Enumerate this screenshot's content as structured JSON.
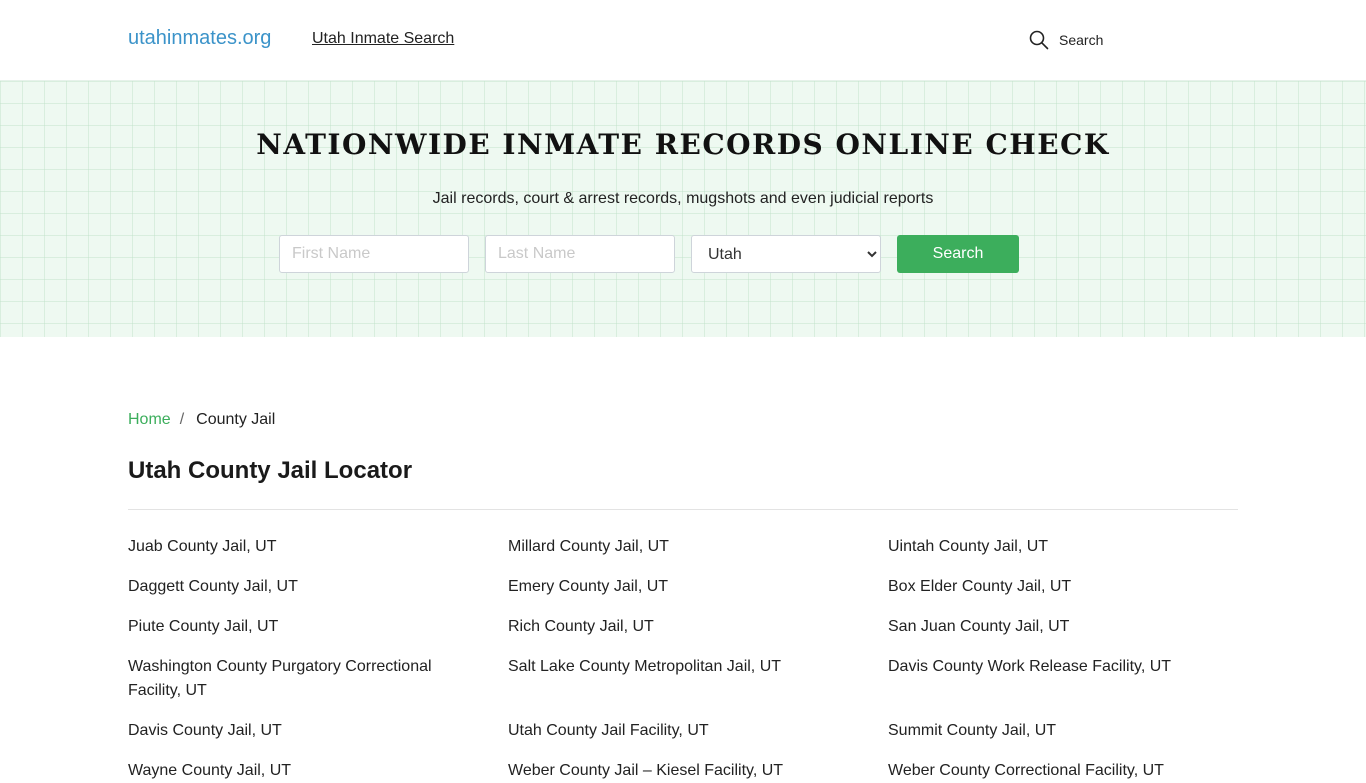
{
  "header": {
    "logo": "utahinmates.org",
    "nav_link": "Utah Inmate Search",
    "search_label": "Search"
  },
  "hero": {
    "title": "NATIONWIDE INMATE RECORDS ONLINE CHECK",
    "subtitle": "Jail records, court & arrest records, mugshots and even judicial reports",
    "first_name_placeholder": "First Name",
    "last_name_placeholder": "Last Name",
    "state_selected": "Utah",
    "search_button": "Search"
  },
  "breadcrumb": {
    "home": "Home",
    "separator": "/",
    "current": "County Jail"
  },
  "page_title": "Utah County Jail Locator",
  "jails": [
    "Juab County Jail, UT",
    "Millard County Jail, UT",
    "Uintah County Jail, UT",
    "Daggett County Jail, UT",
    "Emery County Jail, UT",
    "Box Elder County Jail, UT",
    "Piute County Jail, UT",
    "Rich County Jail, UT",
    "San Juan County Jail, UT",
    "Washington County Purgatory Correctional Facility, UT",
    "Salt Lake County Metropolitan Jail, UT",
    "Davis County Work Release Facility, UT",
    "Davis County Jail, UT",
    "Utah County Jail Facility, UT",
    "Summit County Jail, UT",
    "Wayne County Jail, UT",
    "Weber County Jail – Kiesel Facility, UT",
    "Weber County Correctional Facility, UT"
  ],
  "colors": {
    "logo": "#3b93c9",
    "accent_green": "#3cae5c",
    "hero_bg": "#eef9f1"
  }
}
